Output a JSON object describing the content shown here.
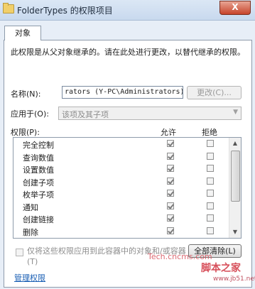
{
  "window": {
    "title": "FolderTypes 的权限项目",
    "close_label": "X"
  },
  "tab": {
    "label": "对象"
  },
  "description": "此权限是从父对象继承的。请在此处进行更改，以替代继承的权限。",
  "name_field": {
    "label": "名称(N):",
    "value": "rators (Y-PC\\Administrators)",
    "change_button": "更改(C)..."
  },
  "apply_to": {
    "label": "应用于(O):",
    "value": "该项及其子项"
  },
  "permissions": {
    "header_label": "权限(P):",
    "allow_header": "允许",
    "deny_header": "拒绝",
    "items": [
      {
        "name": "完全控制",
        "allow": true,
        "deny": false
      },
      {
        "name": "查询数值",
        "allow": true,
        "deny": false
      },
      {
        "name": "设置数值",
        "allow": true,
        "deny": false
      },
      {
        "name": "创建子项",
        "allow": true,
        "deny": false
      },
      {
        "name": "枚举子项",
        "allow": true,
        "deny": false
      },
      {
        "name": "通知",
        "allow": true,
        "deny": false
      },
      {
        "name": "创建链接",
        "allow": true,
        "deny": false
      },
      {
        "name": "删除",
        "allow": true,
        "deny": false
      }
    ]
  },
  "apply_only": {
    "label": "仅将这些权限应用到此容器中的对象和/或容器(T)",
    "checked": false
  },
  "clear_all_button": "全部清除(L)",
  "manage_link": "管理权限",
  "watermarks": [
    "Tech.cncms.com",
    "脚本之家",
    "www.jb51.net"
  ]
}
